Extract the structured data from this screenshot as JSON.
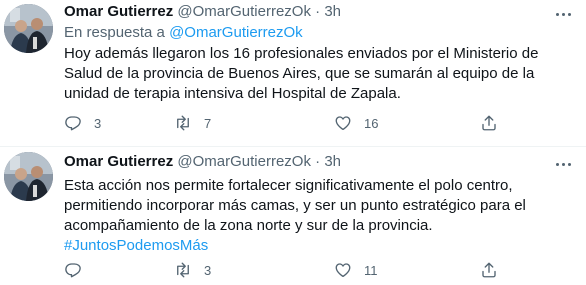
{
  "tweets": [
    {
      "author_name": "Omar Gutierrez",
      "handle": "@OmarGutierrezOk",
      "separator": "·",
      "time": "3h",
      "reply_prefix": "En respuesta a",
      "reply_to": "@OmarGutierrezOk",
      "lines": [
        "Hoy además llegaron los 16 profesionales enviados por el Ministerio de",
        "Salud de la provincia de Buenos Aires, que se sumarán al equipo de la",
        "unidad de terapia intensiva del Hospital de Zapala."
      ],
      "replies": "3",
      "retweets": "7",
      "likes": "16"
    },
    {
      "author_name": "Omar Gutierrez",
      "handle": "@OmarGutierrezOk",
      "separator": "·",
      "time": "3h",
      "lines": [
        "Esta acción nos permite fortalecer significativamente el polo centro,",
        "permitiendo incorporar más camas, y ser un punto estratégico para el",
        "acompañamiento de la zona norte y sur de la provincia."
      ],
      "hashtag": "#JuntosPodemosMás",
      "replies": "",
      "retweets": "3",
      "likes": "11"
    }
  ],
  "icons": {
    "reply": "reply-icon",
    "retweet": "retweet-icon",
    "like": "heart-icon",
    "share": "share-icon",
    "more": "more-icon"
  },
  "colors": {
    "text": "#0f1419",
    "secondary": "#536471",
    "link": "#1d9bf0",
    "divider": "#eff3f4"
  }
}
